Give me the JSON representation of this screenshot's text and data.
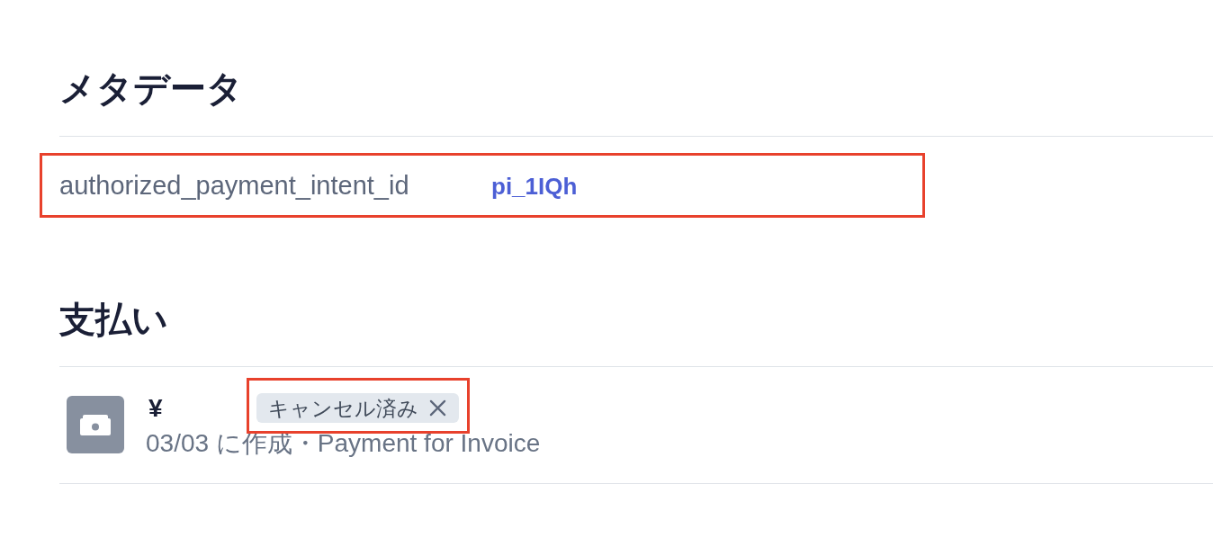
{
  "metadata": {
    "title": "メタデータ",
    "rows": [
      {
        "key": "authorized_payment_intent_id",
        "value": "pi_1IQh",
        "highlighted": true
      }
    ]
  },
  "payments": {
    "title": "支払い",
    "items": [
      {
        "amount": "¥",
        "status": {
          "label": "キャンセル済み",
          "highlighted": true
        },
        "subtitle": "03/03 に作成・Payment for Invoice"
      }
    ]
  }
}
